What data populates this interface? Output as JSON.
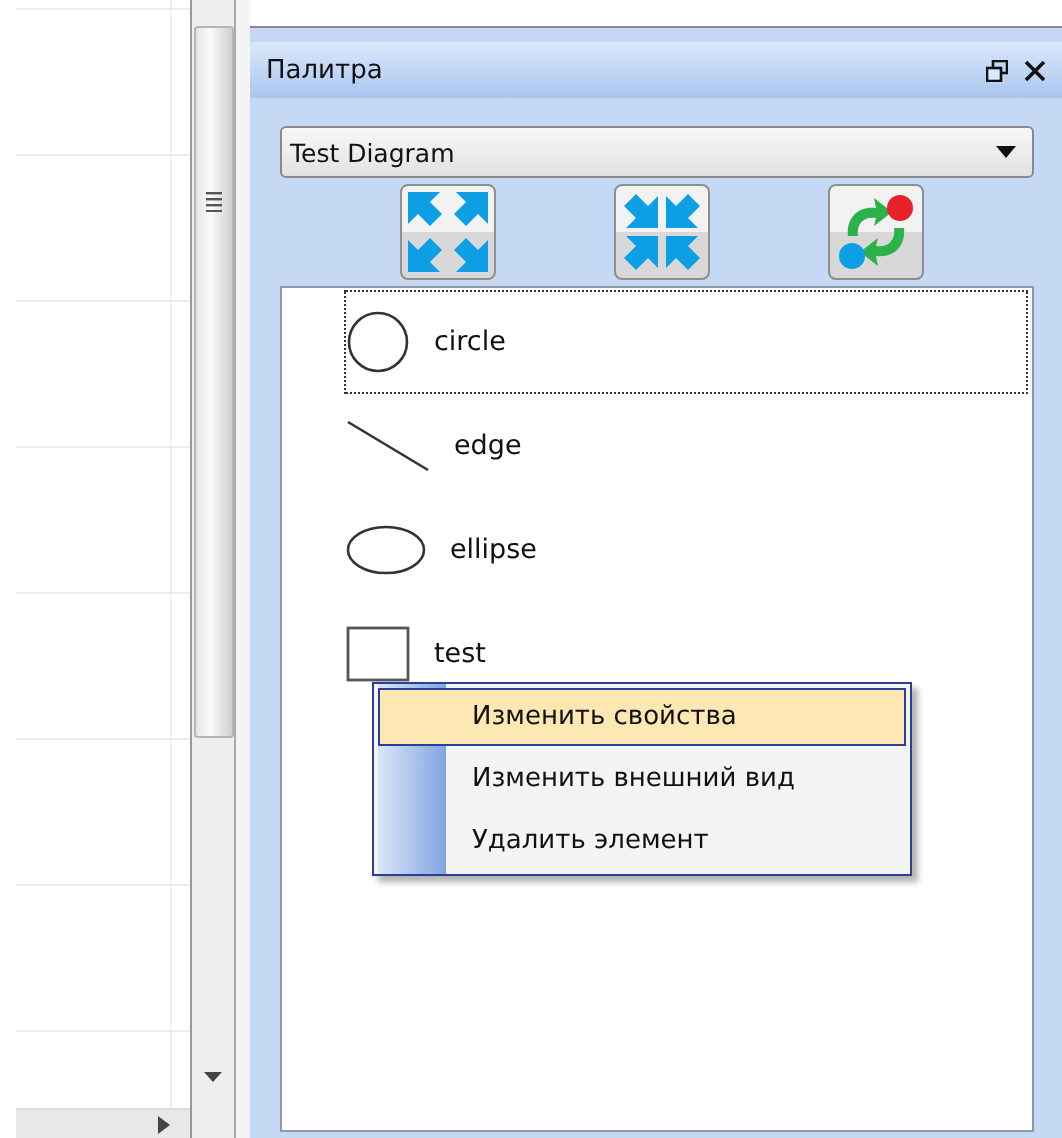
{
  "panel": {
    "title": "Палитра"
  },
  "diagram_select": {
    "value": "Test Diagram"
  },
  "toolbar": [
    {
      "kind": "expand"
    },
    {
      "kind": "collapse"
    },
    {
      "kind": "refresh"
    }
  ],
  "palette_items": [
    {
      "kind": "circle",
      "label": "circle",
      "selected": true
    },
    {
      "kind": "edge",
      "label": "edge",
      "selected": false
    },
    {
      "kind": "ellipse",
      "label": "ellipse",
      "selected": false
    },
    {
      "kind": "rect",
      "label": "test",
      "selected": false
    }
  ],
  "context_menu": [
    {
      "label": "Изменить свойства",
      "selected": true
    },
    {
      "label": "Изменить внешний вид",
      "selected": false
    },
    {
      "label": "Удалить элемент",
      "selected": false
    }
  ]
}
